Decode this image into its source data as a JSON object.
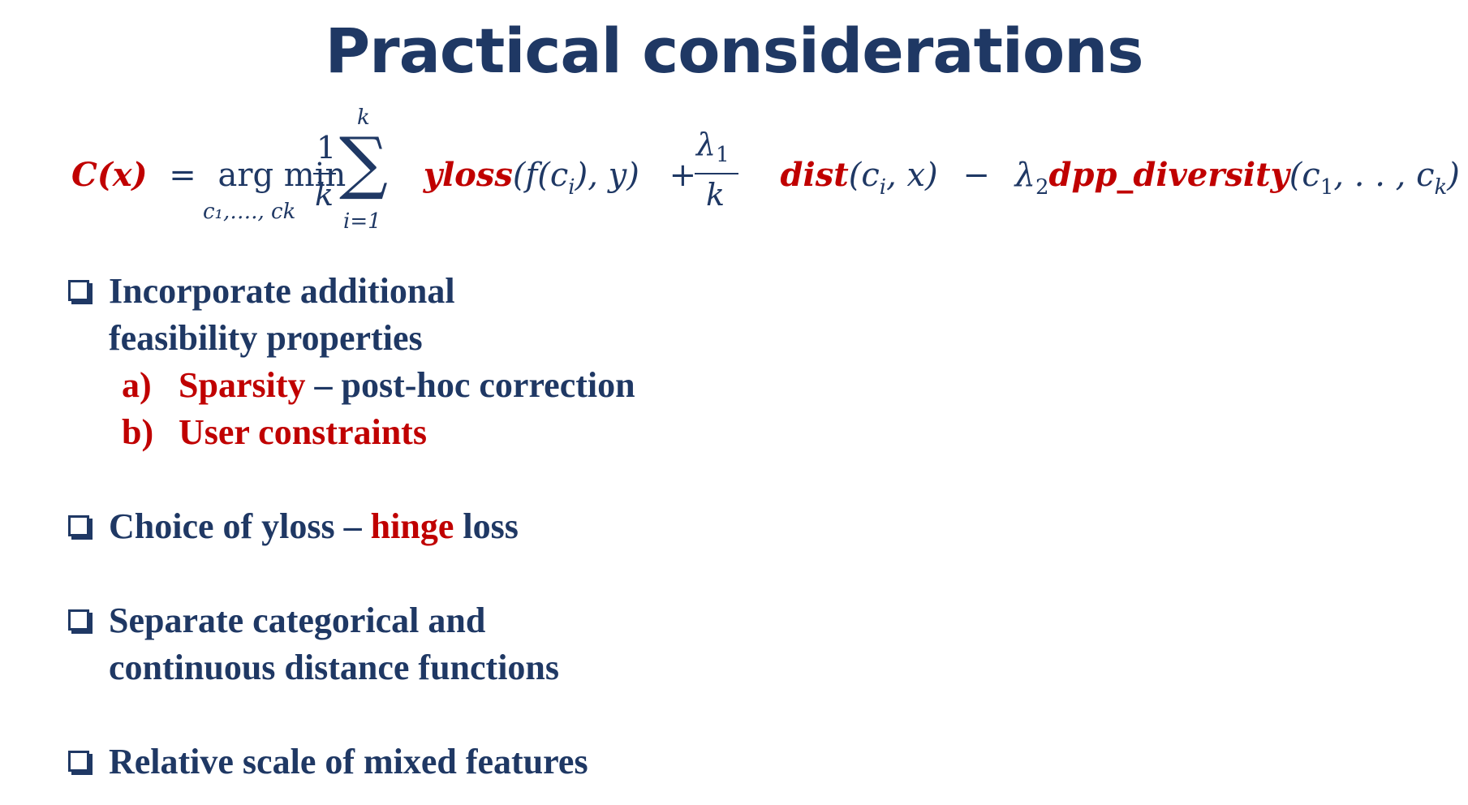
{
  "slide": {
    "title": "Practical considerations"
  },
  "equation": {
    "lhs": "C(x)",
    "eq": "=",
    "argmin": "arg min",
    "argmin_sub": "c₁,…., ck",
    "frac1_num": "1",
    "frac1_den": "k",
    "sum_symbol": "∑",
    "sum_top": "k",
    "sum_bottom": "i=1",
    "yloss": "yloss",
    "yloss_args": "(f(c",
    "yloss_sub": "i",
    "yloss_args_end": "), y)",
    "plus": "+",
    "frac2_num": "λ",
    "frac2_num_sub": "1",
    "frac2_den": "k",
    "dist": "dist",
    "dist_args": "(c",
    "dist_sub": "i",
    "dist_args_end": ", x)",
    "minus": "−",
    "lambda2": "λ",
    "lambda2_sub": "2",
    "dpp": "dpp_diversity",
    "dpp_args": "(c",
    "dpp_sub1": "1",
    "dpp_args_mid": ", . . , c",
    "dpp_sub2": "k",
    "dpp_args_end": ")"
  },
  "bullets": [
    {
      "lines": [
        "Incorporate additional",
        "feasibility properties"
      ],
      "subitems": [
        {
          "letter": "a)",
          "highlight": "Sparsity",
          "rest": " – post-hoc correction"
        },
        {
          "letter": "b)",
          "highlight": "User constraints",
          "rest": ""
        }
      ]
    },
    {
      "prefix": "Choice of yloss – ",
      "highlight": "hinge",
      "suffix": " loss"
    },
    {
      "lines": [
        "Separate categorical and",
        "continuous distance functions"
      ]
    },
    {
      "lines": [
        "Relative scale of mixed features"
      ]
    }
  ],
  "colors": {
    "primary": "#1f3864",
    "accent": "#c00000"
  }
}
